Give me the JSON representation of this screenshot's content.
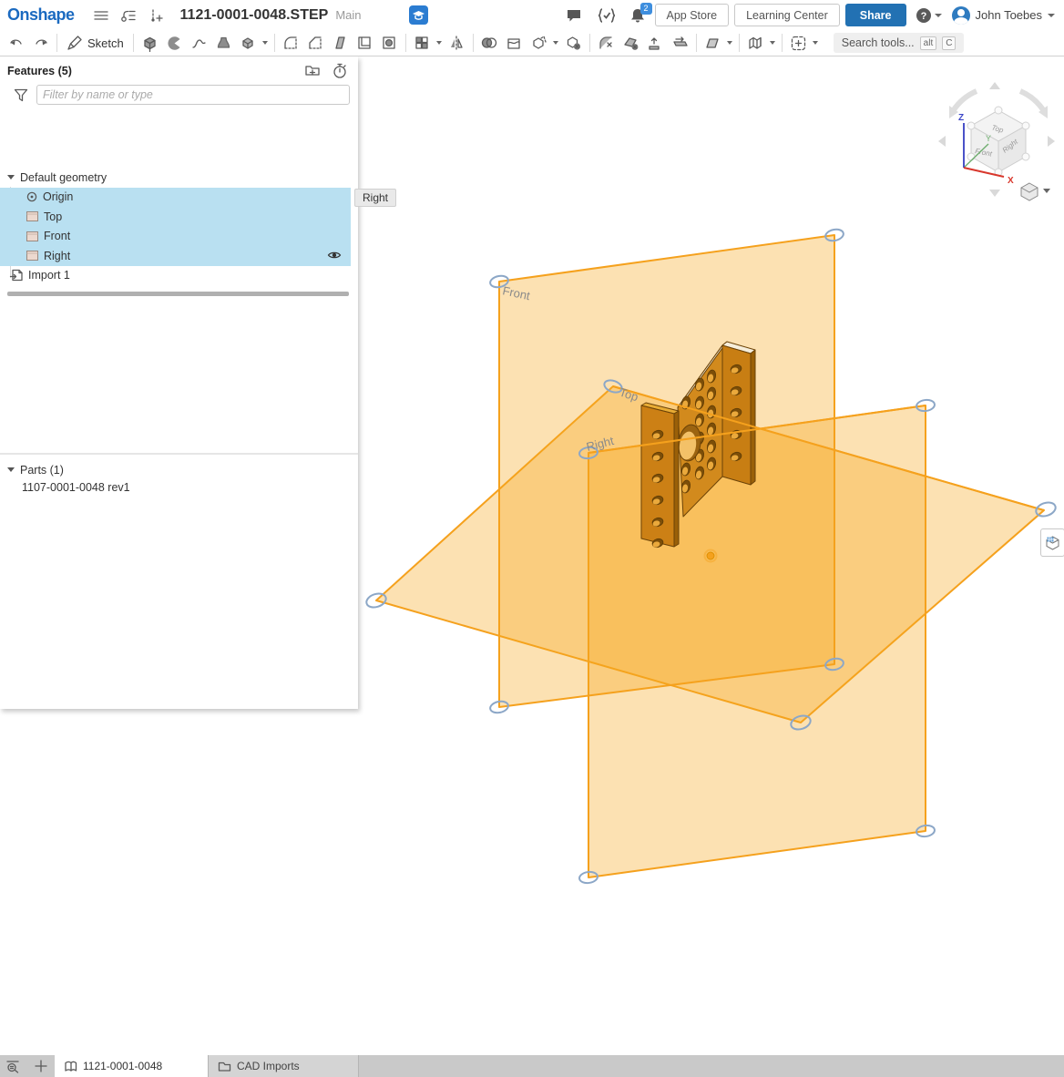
{
  "header": {
    "logo": "Onshape",
    "document_title": "1121-0001-0048.STEP",
    "workspace_name": "Main",
    "notification_count": "2",
    "app_store_label": "App Store",
    "learning_center_label": "Learning Center",
    "share_label": "Share",
    "user_name": "John Toebes"
  },
  "toolbar": {
    "sketch_label": "Sketch",
    "search_placeholder": "Search tools...",
    "shortcut_alt": "alt",
    "shortcut_key": "C"
  },
  "features_panel": {
    "title": "Features (5)",
    "filter_placeholder": "Filter by name or type",
    "default_geometry_label": "Default geometry",
    "items": [
      {
        "label": "Origin"
      },
      {
        "label": "Top"
      },
      {
        "label": "Front"
      },
      {
        "label": "Right"
      }
    ],
    "import_label": "Import 1",
    "parts_title": "Parts (1)",
    "part_name": "1107-0001-0048 rev1",
    "tooltip": "Right"
  },
  "viewport": {
    "plane_labels": {
      "front": "Front",
      "top": "Top",
      "right": "Right"
    },
    "view_cube": {
      "top": "Top",
      "front": "Front",
      "right": "Right",
      "x": "X",
      "y": "Y",
      "z": "Z"
    },
    "colors": {
      "plane": "#F5A11D",
      "part": "#D28A1D",
      "handle": "#8CA7C7",
      "selection": "#B9E0F1",
      "accent_blue": "#2271B3"
    }
  },
  "tabs_bar": {
    "tabs": [
      {
        "label": "1121-0001-0048"
      },
      {
        "label": "CAD Imports"
      }
    ]
  }
}
